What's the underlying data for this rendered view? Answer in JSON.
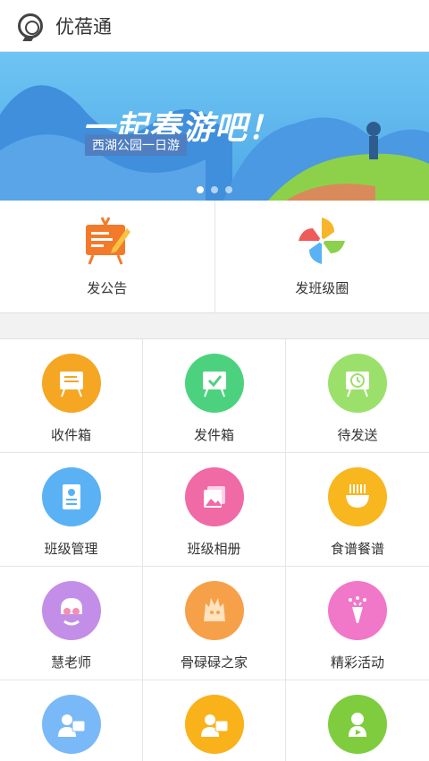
{
  "header": {
    "title": "优蓓通",
    "logo_icon": "app-logo-icon"
  },
  "banner": {
    "title": "一起春游吧！",
    "subtitle": "西湖公园一日游",
    "slides": 3,
    "active_slide": 1
  },
  "actions": [
    {
      "label": "发公告",
      "icon": "announcement-board-icon"
    },
    {
      "label": "发班级圈",
      "icon": "pinwheel-icon"
    }
  ],
  "grid": [
    {
      "label": "收件箱",
      "icon": "inbox-board-icon",
      "color": "#f5a623"
    },
    {
      "label": "发件箱",
      "icon": "outbox-check-icon",
      "color": "#4cd27e"
    },
    {
      "label": "待发送",
      "icon": "clock-board-icon",
      "color": "#9be06b"
    },
    {
      "label": "班级管理",
      "icon": "id-badge-icon",
      "color": "#5ab2f5"
    },
    {
      "label": "班级相册",
      "icon": "photo-album-icon",
      "color": "#f06aa6"
    },
    {
      "label": "食谱餐谱",
      "icon": "noodle-bowl-icon",
      "color": "#f8b61f"
    },
    {
      "label": "慧老师",
      "icon": "teacher-avatar-icon",
      "color": "#c38ee7"
    },
    {
      "label": "骨碌碌之家",
      "icon": "hedgehog-icon",
      "color": "#f7a04a"
    },
    {
      "label": "精彩活动",
      "icon": "party-popper-icon",
      "color": "#f177c9"
    },
    {
      "label": "",
      "icon": "student-card-icon",
      "color": "#7ab9f7"
    },
    {
      "label": "",
      "icon": "teacher-card-icon",
      "color": "#f9b219"
    },
    {
      "label": "",
      "icon": "video-mascot-icon",
      "color": "#7fcd3e"
    }
  ]
}
